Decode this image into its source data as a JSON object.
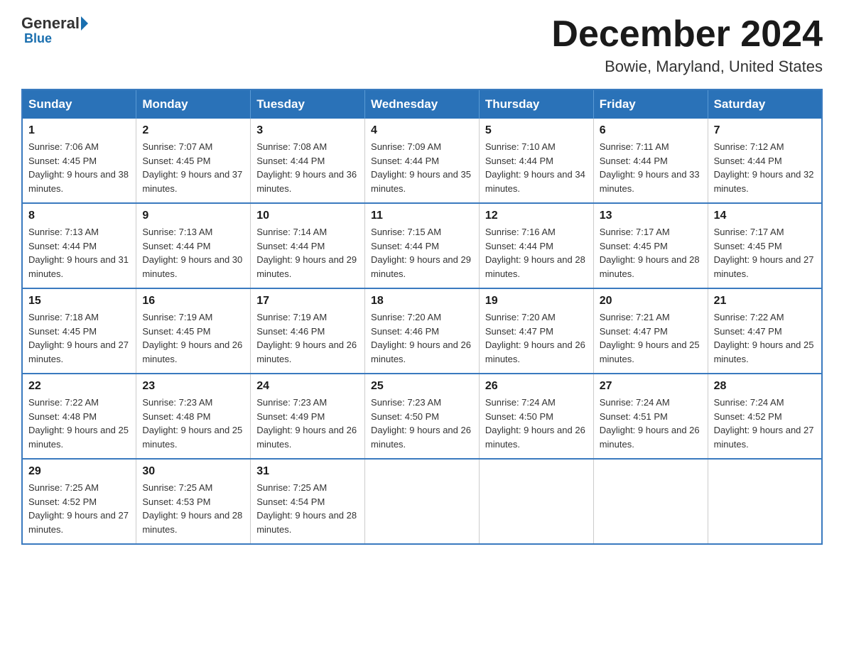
{
  "logo": {
    "general": "General",
    "triangle": "",
    "blue": "Blue"
  },
  "header": {
    "month_title": "December 2024",
    "location": "Bowie, Maryland, United States"
  },
  "weekdays": [
    "Sunday",
    "Monday",
    "Tuesday",
    "Wednesday",
    "Thursday",
    "Friday",
    "Saturday"
  ],
  "weeks": [
    [
      {
        "day": "1",
        "sunrise": "Sunrise: 7:06 AM",
        "sunset": "Sunset: 4:45 PM",
        "daylight": "Daylight: 9 hours and 38 minutes."
      },
      {
        "day": "2",
        "sunrise": "Sunrise: 7:07 AM",
        "sunset": "Sunset: 4:45 PM",
        "daylight": "Daylight: 9 hours and 37 minutes."
      },
      {
        "day": "3",
        "sunrise": "Sunrise: 7:08 AM",
        "sunset": "Sunset: 4:44 PM",
        "daylight": "Daylight: 9 hours and 36 minutes."
      },
      {
        "day": "4",
        "sunrise": "Sunrise: 7:09 AM",
        "sunset": "Sunset: 4:44 PM",
        "daylight": "Daylight: 9 hours and 35 minutes."
      },
      {
        "day": "5",
        "sunrise": "Sunrise: 7:10 AM",
        "sunset": "Sunset: 4:44 PM",
        "daylight": "Daylight: 9 hours and 34 minutes."
      },
      {
        "day": "6",
        "sunrise": "Sunrise: 7:11 AM",
        "sunset": "Sunset: 4:44 PM",
        "daylight": "Daylight: 9 hours and 33 minutes."
      },
      {
        "day": "7",
        "sunrise": "Sunrise: 7:12 AM",
        "sunset": "Sunset: 4:44 PM",
        "daylight": "Daylight: 9 hours and 32 minutes."
      }
    ],
    [
      {
        "day": "8",
        "sunrise": "Sunrise: 7:13 AM",
        "sunset": "Sunset: 4:44 PM",
        "daylight": "Daylight: 9 hours and 31 minutes."
      },
      {
        "day": "9",
        "sunrise": "Sunrise: 7:13 AM",
        "sunset": "Sunset: 4:44 PM",
        "daylight": "Daylight: 9 hours and 30 minutes."
      },
      {
        "day": "10",
        "sunrise": "Sunrise: 7:14 AM",
        "sunset": "Sunset: 4:44 PM",
        "daylight": "Daylight: 9 hours and 29 minutes."
      },
      {
        "day": "11",
        "sunrise": "Sunrise: 7:15 AM",
        "sunset": "Sunset: 4:44 PM",
        "daylight": "Daylight: 9 hours and 29 minutes."
      },
      {
        "day": "12",
        "sunrise": "Sunrise: 7:16 AM",
        "sunset": "Sunset: 4:44 PM",
        "daylight": "Daylight: 9 hours and 28 minutes."
      },
      {
        "day": "13",
        "sunrise": "Sunrise: 7:17 AM",
        "sunset": "Sunset: 4:45 PM",
        "daylight": "Daylight: 9 hours and 28 minutes."
      },
      {
        "day": "14",
        "sunrise": "Sunrise: 7:17 AM",
        "sunset": "Sunset: 4:45 PM",
        "daylight": "Daylight: 9 hours and 27 minutes."
      }
    ],
    [
      {
        "day": "15",
        "sunrise": "Sunrise: 7:18 AM",
        "sunset": "Sunset: 4:45 PM",
        "daylight": "Daylight: 9 hours and 27 minutes."
      },
      {
        "day": "16",
        "sunrise": "Sunrise: 7:19 AM",
        "sunset": "Sunset: 4:45 PM",
        "daylight": "Daylight: 9 hours and 26 minutes."
      },
      {
        "day": "17",
        "sunrise": "Sunrise: 7:19 AM",
        "sunset": "Sunset: 4:46 PM",
        "daylight": "Daylight: 9 hours and 26 minutes."
      },
      {
        "day": "18",
        "sunrise": "Sunrise: 7:20 AM",
        "sunset": "Sunset: 4:46 PM",
        "daylight": "Daylight: 9 hours and 26 minutes."
      },
      {
        "day": "19",
        "sunrise": "Sunrise: 7:20 AM",
        "sunset": "Sunset: 4:47 PM",
        "daylight": "Daylight: 9 hours and 26 minutes."
      },
      {
        "day": "20",
        "sunrise": "Sunrise: 7:21 AM",
        "sunset": "Sunset: 4:47 PM",
        "daylight": "Daylight: 9 hours and 25 minutes."
      },
      {
        "day": "21",
        "sunrise": "Sunrise: 7:22 AM",
        "sunset": "Sunset: 4:47 PM",
        "daylight": "Daylight: 9 hours and 25 minutes."
      }
    ],
    [
      {
        "day": "22",
        "sunrise": "Sunrise: 7:22 AM",
        "sunset": "Sunset: 4:48 PM",
        "daylight": "Daylight: 9 hours and 25 minutes."
      },
      {
        "day": "23",
        "sunrise": "Sunrise: 7:23 AM",
        "sunset": "Sunset: 4:48 PM",
        "daylight": "Daylight: 9 hours and 25 minutes."
      },
      {
        "day": "24",
        "sunrise": "Sunrise: 7:23 AM",
        "sunset": "Sunset: 4:49 PM",
        "daylight": "Daylight: 9 hours and 26 minutes."
      },
      {
        "day": "25",
        "sunrise": "Sunrise: 7:23 AM",
        "sunset": "Sunset: 4:50 PM",
        "daylight": "Daylight: 9 hours and 26 minutes."
      },
      {
        "day": "26",
        "sunrise": "Sunrise: 7:24 AM",
        "sunset": "Sunset: 4:50 PM",
        "daylight": "Daylight: 9 hours and 26 minutes."
      },
      {
        "day": "27",
        "sunrise": "Sunrise: 7:24 AM",
        "sunset": "Sunset: 4:51 PM",
        "daylight": "Daylight: 9 hours and 26 minutes."
      },
      {
        "day": "28",
        "sunrise": "Sunrise: 7:24 AM",
        "sunset": "Sunset: 4:52 PM",
        "daylight": "Daylight: 9 hours and 27 minutes."
      }
    ],
    [
      {
        "day": "29",
        "sunrise": "Sunrise: 7:25 AM",
        "sunset": "Sunset: 4:52 PM",
        "daylight": "Daylight: 9 hours and 27 minutes."
      },
      {
        "day": "30",
        "sunrise": "Sunrise: 7:25 AM",
        "sunset": "Sunset: 4:53 PM",
        "daylight": "Daylight: 9 hours and 28 minutes."
      },
      {
        "day": "31",
        "sunrise": "Sunrise: 7:25 AM",
        "sunset": "Sunset: 4:54 PM",
        "daylight": "Daylight: 9 hours and 28 minutes."
      },
      null,
      null,
      null,
      null
    ]
  ]
}
